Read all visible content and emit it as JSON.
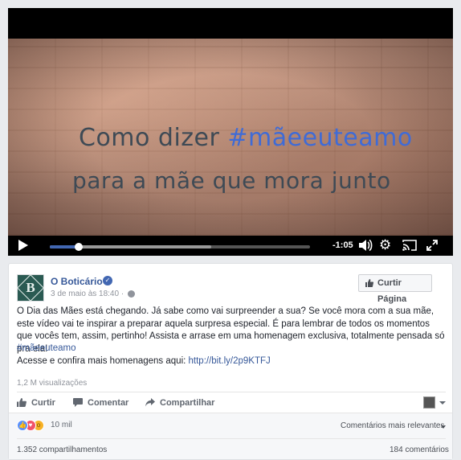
{
  "video": {
    "caption_line1_prefix": "Como dizer ",
    "caption_line1_hashtag": "#mãeeuteamo",
    "caption_line2": "para a mãe que mora junto",
    "time_remaining": "-1:05",
    "progress_played": 0.11,
    "progress_buffered": 0.62,
    "icons": [
      "play-icon",
      "volume-icon",
      "gear-icon",
      "cast-icon",
      "fullscreen-icon"
    ]
  },
  "post": {
    "page_name": "O Boticário",
    "avatar_letter": "B",
    "date": "3 de maio às 18:40 ·",
    "like_page_label": "Curtir Página",
    "body": "O Dia das Mães está chegando. Já sabe como vai surpreender a sua? Se você mora com a sua mãe, este vídeo vai te inspirar a preparar aquela surpresa especial. É para lembrar de todos os momentos que vocês tem, assim, pertinho! Assista e arrase em uma homenagem exclusiva, totalmente pensada só pra ela!",
    "hashtag": "#mãeeuteamo",
    "more_text": "Acesse e confira mais homenagens aqui: ",
    "more_link": "http://bit.ly/2p9KTFJ",
    "views": "1,2 M visualizações",
    "actions": {
      "like": "Curtir",
      "comment": "Comentar",
      "share": "Compartilhar"
    },
    "reactions_count": "10 mil",
    "comments_filter": "Comentários mais relevantes",
    "shares": "1.352 compartilhamentos",
    "comments_count": "184 comentários"
  },
  "colors": {
    "link": "#365899",
    "accent": "#4267b2",
    "muted": "#90949c"
  }
}
